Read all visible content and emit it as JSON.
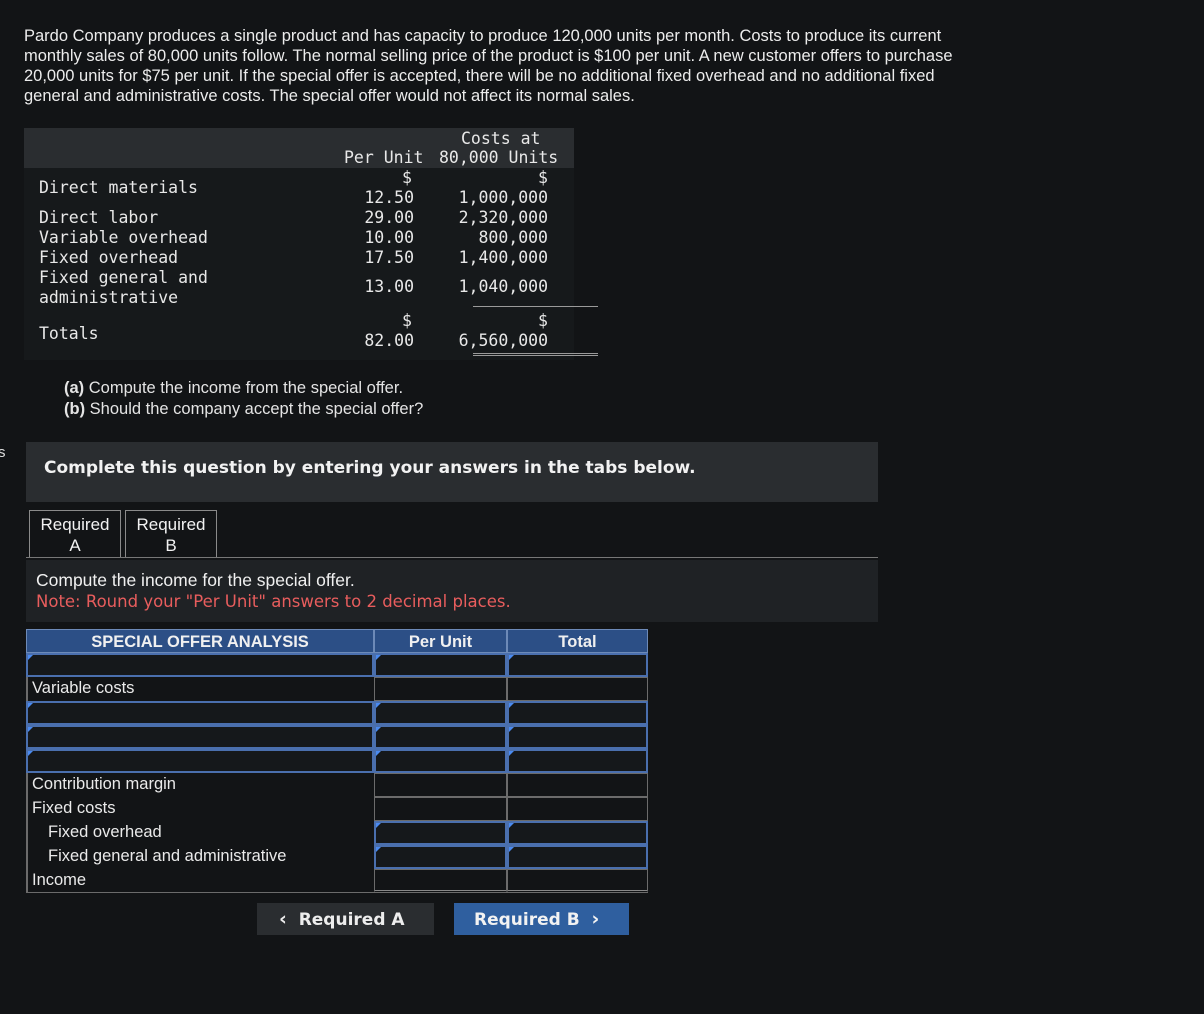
{
  "problem_text": "Pardo Company produces a single product and has capacity to produce 120,000 units per month. Costs to produce its current monthly sales of 80,000 units follow. The normal selling price of the product is $100 per unit. A new customer offers to purchase 20,000 units for $75 per unit. If the special offer is accepted, there will be no additional fixed overhead and no additional fixed general and administrative costs. The special offer would not affect its normal sales.",
  "side_letter": "s",
  "cost_table": {
    "header_per_unit": "Per Unit",
    "header_costs_line1": "Costs at",
    "header_costs_line2": "80,000 Units",
    "currency": "$",
    "rows": [
      {
        "label": "Direct materials",
        "per_unit": "12.50",
        "total": "1,000,000"
      },
      {
        "label": "Direct labor",
        "per_unit": "29.00",
        "total": "2,320,000"
      },
      {
        "label": "Variable overhead",
        "per_unit": "10.00",
        "total": "800,000"
      },
      {
        "label": "Fixed overhead",
        "per_unit": "17.50",
        "total": "1,400,000"
      },
      {
        "label_line1": "Fixed general and",
        "label_line2": "administrative",
        "per_unit": "13.00",
        "total": "1,040,000"
      }
    ],
    "totals": {
      "label": "Totals",
      "per_unit": "82.00",
      "total": "6,560,000"
    }
  },
  "questions": {
    "a_tag": "(a)",
    "a_text": " Compute the income from the special offer.",
    "b_tag": "(b)",
    "b_text": " Should the company accept the special offer?"
  },
  "banner": "Complete this question by entering your answers in the tabs below.",
  "tabs": [
    {
      "line1": "Required",
      "line2": "A"
    },
    {
      "line1": "Required",
      "line2": "B"
    }
  ],
  "instructions": {
    "line1": "Compute the income for the special offer.",
    "note": "Note: Round your \"Per Unit\" answers to 2 decimal places."
  },
  "analysis": {
    "col_label": "SPECIAL OFFER ANALYSIS",
    "col_per_unit": "Per Unit",
    "col_total": "Total",
    "variable_costs": "Variable costs",
    "contribution_margin": "Contribution margin",
    "fixed_costs": "Fixed costs",
    "fixed_overhead": "Fixed overhead",
    "fixed_ga": "Fixed general and administrative",
    "income": "Income"
  },
  "nav": {
    "prev_label": "Required A",
    "next_label": "Required B",
    "prev_icon": "chevron-left-icon",
    "next_icon": "chevron-right-icon"
  }
}
